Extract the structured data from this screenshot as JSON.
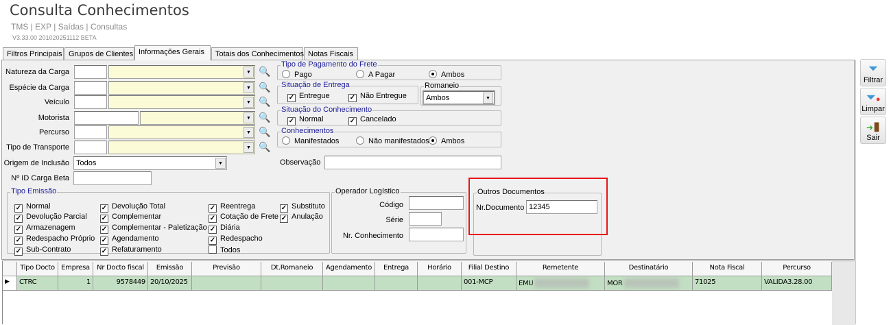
{
  "header": {
    "title": "Consulta Conhecimentos",
    "breadcrumb": "TMS | EXP | Saídas | Consultas",
    "version": "V3.33.00 201020251112 BETA"
  },
  "tabs": [
    {
      "label": "Filtros Principais"
    },
    {
      "label": "Grupos de Clientes"
    },
    {
      "label": "Informações Gerais",
      "active": true
    },
    {
      "label": "Totais dos Conhecimentos"
    },
    {
      "label": "Notas Fiscais"
    }
  ],
  "filters": {
    "natureza": "Natureza da Carga",
    "especie": "Espécie da Carga",
    "veiculo": "Veículo",
    "motorista": "Motorista",
    "percurso": "Percurso",
    "transporte": "Tipo de Transporte",
    "origem": "Origem de Inclusão",
    "origem_value": "Todos",
    "id_carga": "Nº ID Carga Beta",
    "observacao": "Observação"
  },
  "pagamento": {
    "title": "Tipo de Pagamento do Frete",
    "options": [
      "Pago",
      "A Pagar",
      "Ambos"
    ],
    "selected": "Ambos"
  },
  "entrega": {
    "title": "Situação de Entrega",
    "options": [
      "Entregue",
      "Não Entregue"
    ]
  },
  "romaneio": {
    "title": "Romaneio",
    "value": "Ambos"
  },
  "situacao": {
    "title": "Situação do Conhecimento",
    "options": [
      "Normal",
      "Cancelado"
    ]
  },
  "conhecimentos": {
    "title": "Conhecimentos",
    "options": [
      "Manifestados",
      "Não manifestados",
      "Ambos"
    ],
    "selected": "Ambos"
  },
  "tipo_emissao": {
    "title": "Tipo Emissão",
    "items": [
      {
        "label": "Normal",
        "checked": true
      },
      {
        "label": "Devolução Parcial",
        "checked": true
      },
      {
        "label": "Armazenagem",
        "checked": true
      },
      {
        "label": "Redespacho Próprio",
        "checked": true
      },
      {
        "label": "Sub-Contrato",
        "checked": true
      },
      {
        "label": "Devolução Total",
        "checked": true
      },
      {
        "label": "Complementar",
        "checked": true
      },
      {
        "label": "Complementar - Paletização",
        "checked": true
      },
      {
        "label": "Agendamento",
        "checked": true
      },
      {
        "label": "Refaturamento",
        "checked": true
      },
      {
        "label": "Reentrega",
        "checked": true
      },
      {
        "label": "Cotação de Frete",
        "checked": true
      },
      {
        "label": "Diária",
        "checked": true
      },
      {
        "label": "Redespacho",
        "checked": true
      },
      {
        "label": "Todos",
        "checked": false
      },
      {
        "label": "Substituto",
        "checked": true
      },
      {
        "label": "Anulação",
        "checked": true
      }
    ]
  },
  "operador": {
    "title": "Operador Logístico",
    "codigo": "Código",
    "serie": "Série",
    "nr": "Nr. Conhecimento"
  },
  "outros": {
    "title": "Outros Documentos",
    "label": "Nr.Documento",
    "value": "12345"
  },
  "sidebar": {
    "filtrar": "Filtrar",
    "limpar": "Limpar",
    "sair": "Sair"
  },
  "grid": {
    "columns": [
      "Tipo Docto",
      "Empresa",
      "Nr Docto fiscal",
      "Emissão",
      "Previsão",
      "Dt.Romaneio",
      "Agendamento",
      "Entrega",
      "Horário",
      "Filial Destino",
      "Remetente",
      "Destinatário",
      "Nota Fiscal",
      "Percurso"
    ],
    "rows": [
      [
        "CTRC",
        "1",
        "9578449",
        "20/10/2025",
        "",
        "",
        "",
        "",
        "",
        "001-MCP",
        "EMU",
        "MOR",
        "71025",
        "VALIDA3.28.00"
      ]
    ]
  }
}
